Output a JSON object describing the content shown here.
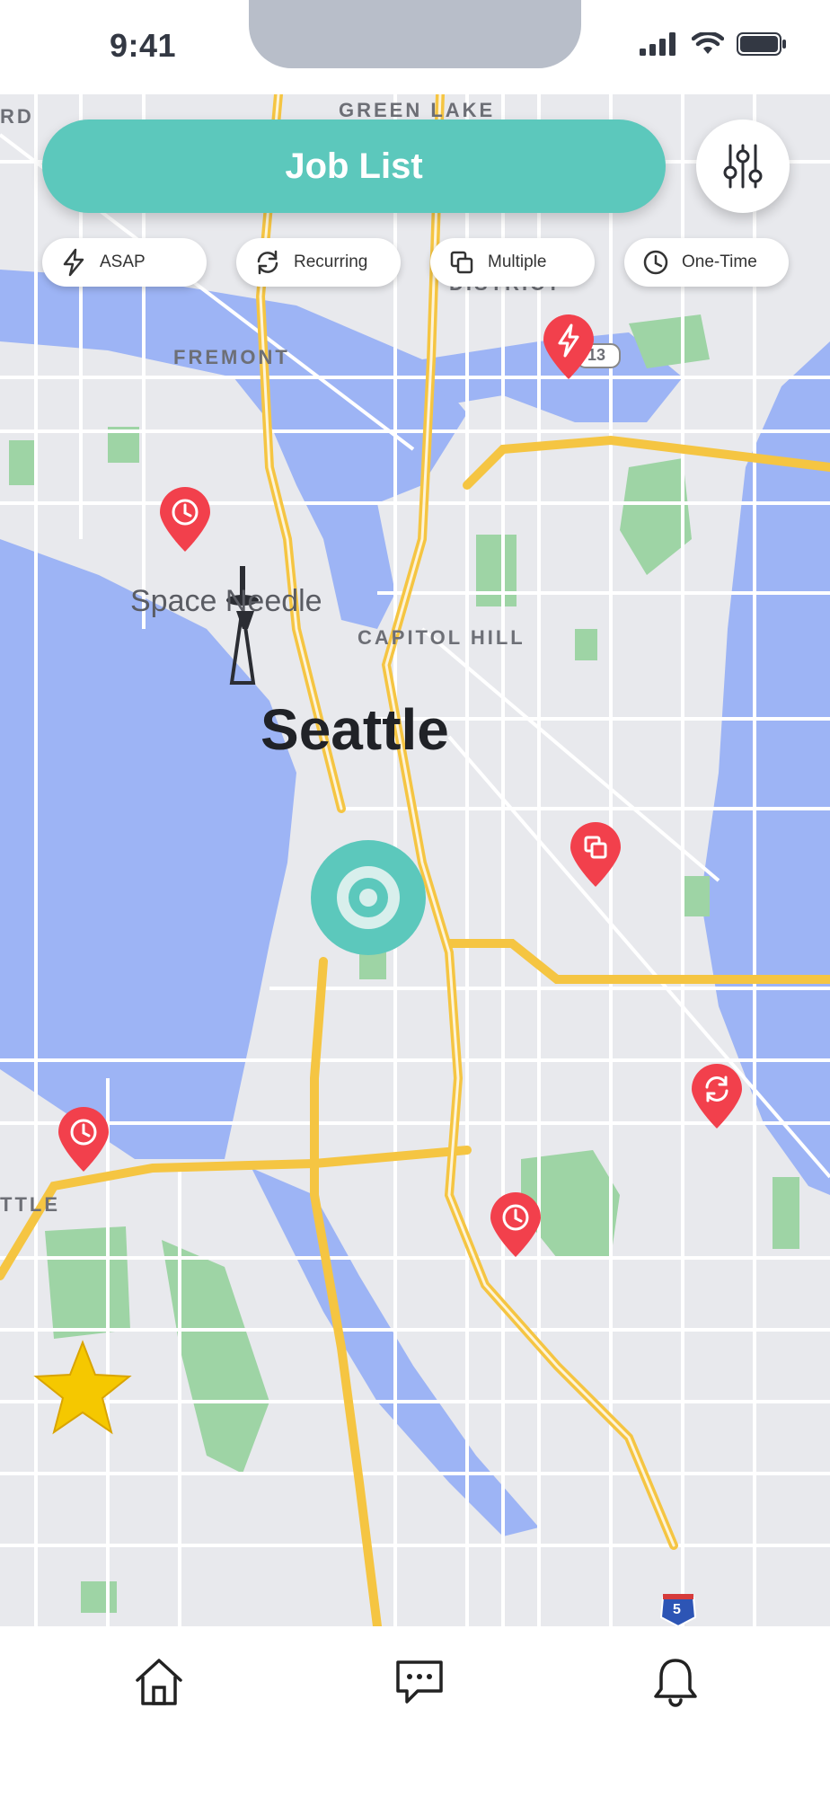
{
  "status_bar": {
    "time": "9:41",
    "icons": [
      "signal-icon",
      "wifi-icon",
      "battery-icon"
    ]
  },
  "header": {
    "job_list_label": "Job List",
    "filter_icon": "sliders-icon"
  },
  "filters": [
    {
      "label": "ASAP",
      "icon": "lightning-icon"
    },
    {
      "label": "Recurring",
      "icon": "recurring-icon"
    },
    {
      "label": "Multiple",
      "icon": "multiple-icon"
    },
    {
      "label": "One-Time",
      "icon": "clock-icon"
    }
  ],
  "map": {
    "labels": {
      "green_lake": "GREEN LAKE",
      "ard": "RD",
      "district": "DISTRICT",
      "fremont": "FREMONT",
      "capitol_hill": "CAPITOL HILL",
      "space_needle": "Space Needle",
      "seattle": "Seattle",
      "ttle": "TTLE",
      "route_13": "13",
      "interstate_5": "5"
    },
    "pins": [
      {
        "type": "ASAP",
        "icon": "lightning-icon"
      },
      {
        "type": "One-Time",
        "icon": "clock-icon"
      },
      {
        "type": "Multiple",
        "icon": "multiple-icon"
      },
      {
        "type": "Recurring",
        "icon": "recurring-icon"
      },
      {
        "type": "One-Time",
        "icon": "clock-icon"
      },
      {
        "type": "One-Time",
        "icon": "clock-icon"
      }
    ],
    "current_location_icon": "current-location-icon",
    "favorite_icon": "star-icon"
  },
  "bottom_nav": [
    {
      "name": "home",
      "icon": "home-icon"
    },
    {
      "name": "messages",
      "icon": "chat-icon"
    },
    {
      "name": "notifications",
      "icon": "bell-icon"
    }
  ],
  "colors": {
    "accent": "#5cc8bc",
    "pin": "#f2404c",
    "water": "#9db4f5",
    "park": "#9ed4a5",
    "highway": "#f5c542",
    "land": "#e8e9ed",
    "star": "#f5c800"
  }
}
